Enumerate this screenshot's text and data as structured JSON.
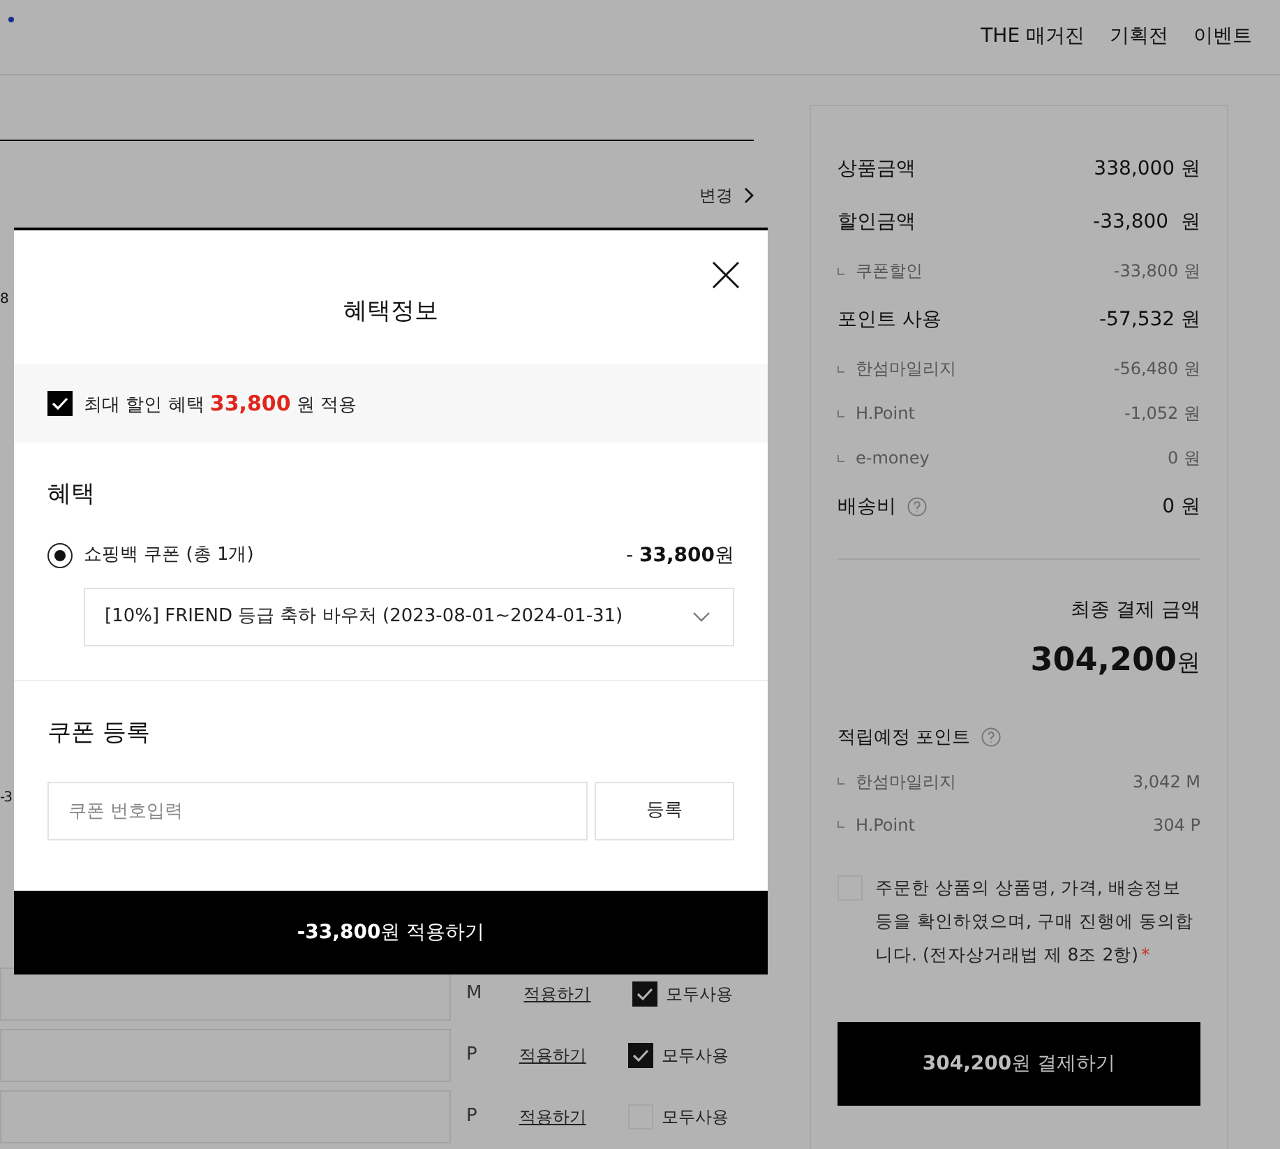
{
  "header": {
    "nav": [
      "THE 매거진",
      "기획전",
      "이벤트"
    ]
  },
  "left_panel": {
    "change_link": "변경",
    "edge_fragments": [
      "8",
      "-3"
    ],
    "point_rows": [
      {
        "unit": "M",
        "apply": "적용하기",
        "use_all": "모두사용",
        "checked": true
      },
      {
        "unit": "P",
        "apply": "적용하기",
        "use_all": "모두사용",
        "checked": true
      },
      {
        "unit": "P",
        "apply": "적용하기",
        "use_all": "모두사용",
        "checked": false
      }
    ]
  },
  "modal": {
    "title": "혜택정보",
    "max_discount": {
      "checked": true,
      "prefix": "최대 할인 혜택",
      "amount": "33,800",
      "suffix": "원 적용"
    },
    "benefit_heading": "혜택",
    "coupon_option": {
      "selected": true,
      "label": "쇼핑백 쿠폰 (총 1개)",
      "amount": "- **33,800**원"
    },
    "coupon_select": {
      "value": "[10%] FRIEND 등급 축하 바우처 (2023-08-01~2024-01-31)"
    },
    "register_heading": "쿠폰 등록",
    "coupon_input": {
      "placeholder": "쿠폰 번호입력"
    },
    "register_button": "등록",
    "apply_button": "**-33,800**원 적용하기"
  },
  "summary": {
    "rows": [
      {
        "kind": "main",
        "label": "상품금액",
        "value": "338,000 원",
        "help": false
      },
      {
        "kind": "main",
        "label": "할인금액",
        "value": "-33,800  원",
        "help": false
      },
      {
        "kind": "sub",
        "label": "쿠폰할인",
        "value": "-33,800 원",
        "help": false
      },
      {
        "kind": "main",
        "label": "포인트 사용",
        "value": "-57,532 원",
        "help": false
      },
      {
        "kind": "sub",
        "label": "한섬마일리지",
        "value": "-56,480 원",
        "help": false
      },
      {
        "kind": "sub",
        "label": "H.Point",
        "value": "-1,052 원",
        "help": false
      },
      {
        "kind": "sub",
        "label": "e-money",
        "value": "0 원",
        "help": false
      },
      {
        "kind": "main",
        "label": "배송비",
        "value": "0 원",
        "help": true
      }
    ],
    "total_label": "최종 결제 금액",
    "total_amount": "304,200",
    "total_unit": "원",
    "points_heading": "적립예정 포인트",
    "points_help": true,
    "points_rows": [
      {
        "label": "한섬마일리지",
        "value": "3,042 M"
      },
      {
        "label": "H.Point",
        "value": "304 P"
      }
    ],
    "agreement": {
      "checked": false,
      "text": "주문한 상품의 상품명, 가격, 배송정보 등을 확인하였으며, 구매 진행에 동의합니다. (전자상거래법 제 8조 2항)",
      "required_mark": "*"
    },
    "pay_button": "**304,200**원 결제하기"
  }
}
